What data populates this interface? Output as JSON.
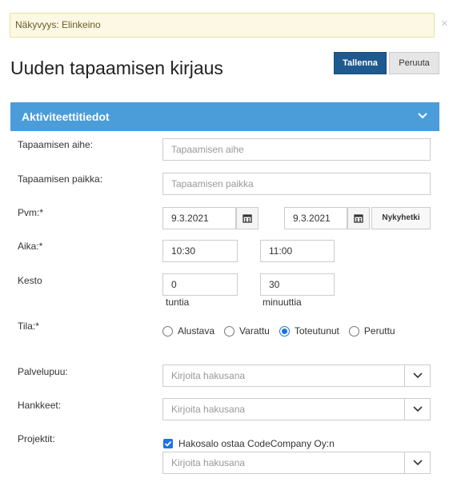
{
  "notice": {
    "text": "Näkyvyys: Elinkeino",
    "close": "×"
  },
  "page": {
    "title": "Uuden tapaamisen kirjaus"
  },
  "toolbar": {
    "save_label": "Tallenna",
    "cancel_label": "Peruuta"
  },
  "section": {
    "title": "Aktiviteettitiedot",
    "chevron_icon": "chevron-down-icon"
  },
  "form": {
    "subject": {
      "label": "Tapaamisen aihe:",
      "placeholder": "Tapaamisen aihe"
    },
    "place": {
      "label": "Tapaamisen paikka:",
      "placeholder": "Tapaamisen paikka"
    },
    "date": {
      "label": "Pvm:*",
      "start": "9.3.2021",
      "end": "9.3.2021",
      "now_label": "Nykyhetki",
      "calendar_icon": "calendar-icon"
    },
    "time": {
      "label": "Aika:*",
      "start": "10:30",
      "end": "11:00"
    },
    "duration": {
      "label": "Kesto",
      "hours": "0",
      "hours_unit": "tuntia",
      "minutes": "30",
      "minutes_unit": "minuuttia"
    },
    "status": {
      "label": "Tila:*",
      "options": [
        "Alustava",
        "Varattu",
        "Toteutunut",
        "Peruttu"
      ],
      "selected": "Toteutunut"
    },
    "service_tree": {
      "label": "Palvelupuu:",
      "placeholder": "Kirjoita hakusana"
    },
    "projects_field": {
      "label": "Hankkeet:",
      "placeholder": "Kirjoita hakusana"
    },
    "projektit": {
      "label": "Projektit:",
      "checked_item": "Hakosalo ostaa CodeCompany Oy:n",
      "checked": true,
      "placeholder": "Kirjoita hakusana"
    }
  },
  "colors": {
    "accent": "#4a9dd9",
    "primary_button": "#1e5a8f",
    "notice_bg": "#fcf8e3"
  }
}
